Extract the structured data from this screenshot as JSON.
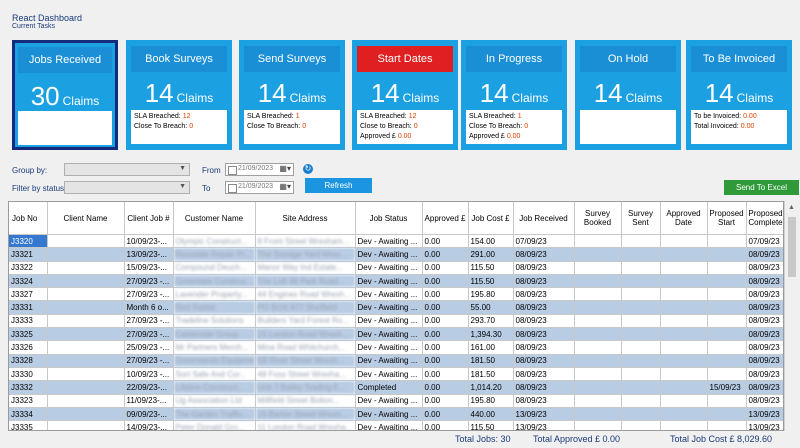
{
  "app": {
    "title": "React Dashboard",
    "subtitle": "Current Tasks"
  },
  "cards": [
    {
      "title": "Jobs Received",
      "count": "30",
      "unit": "Claims",
      "active": true,
      "lines": []
    },
    {
      "title": "Book Surveys",
      "count": "14",
      "unit": "Claims",
      "lines": [
        {
          "label": "SLA Breached:",
          "value": "12"
        },
        {
          "label": "Close To Breach:",
          "value": "0"
        }
      ]
    },
    {
      "title": "Send Surveys",
      "count": "14",
      "unit": "Claims",
      "lines": [
        {
          "label": "SLA Breached:",
          "value": "1"
        },
        {
          "label": "Close To Breach:",
          "value": "0"
        }
      ]
    },
    {
      "title": "Start Dates",
      "count": "14",
      "unit": "Claims",
      "red": true,
      "lines": [
        {
          "label": "SLA Breached:",
          "value": "12"
        },
        {
          "label": "Close to Breach:",
          "value": "0"
        },
        {
          "label": "Approved £",
          "value": "0.00"
        }
      ]
    },
    {
      "title": "In Progress",
      "count": "14",
      "unit": "Claims",
      "lines": [
        {
          "label": "SLA Breached:",
          "value": "1"
        },
        {
          "label": "Close To Breach:",
          "value": "0"
        },
        {
          "label": "Approved £",
          "value": "0.00"
        }
      ]
    },
    {
      "title": "On Hold",
      "count": "14",
      "unit": "Claims",
      "lines": []
    },
    {
      "title": "To Be Invoiced",
      "count": "14",
      "unit": "Claims",
      "lines": [
        {
          "label": "To be Invoiced:",
          "value": "0.00"
        },
        {
          "label": "Total Invoiced:",
          "value": "0.00"
        }
      ]
    }
  ],
  "filters": {
    "group_by_label": "Group by:",
    "filter_status_label": "Filter by status:",
    "from_label": "From",
    "to_label": "To",
    "from_date": "21/09/2023",
    "to_date": "21/09/2023",
    "refresh_label": "Refresh",
    "excel_label": "Send To Excel"
  },
  "table": {
    "columns": [
      "Job No",
      "Client Name",
      "Client Job #",
      "Customer Name",
      "Site Address",
      "Job Status",
      "Approved £",
      "Job Cost £",
      "Job Received",
      "Survey Booked",
      "Survey Sent",
      "Approved Date",
      "Proposed Start",
      "Proposed Complete"
    ],
    "rows": [
      [
        "J3320",
        "",
        "10/09/23-...",
        "Olympic Construct...",
        "8 Front Street Wrexham...",
        "Dev - Awaiting ...",
        "0.00",
        "154.00",
        "07/09/23",
        "",
        "",
        "",
        "",
        "07/09/23"
      ],
      [
        "J3321",
        "",
        "13/09/23-...",
        "Rossdale Repair Pr...",
        "The Storage Yard Wrex...",
        "Dev - Awaiting ...",
        "0.00",
        "291.00",
        "08/09/23",
        "",
        "",
        "",
        "",
        "08/09/23"
      ],
      [
        "J3322",
        "",
        "15/09/23-...",
        "Compound Deuch...",
        "Manor Way Ind Estate...",
        "Dev - Awaiting ...",
        "0.00",
        "115.50",
        "08/09/23",
        "",
        "",
        "",
        "",
        "08/09/23"
      ],
      [
        "J3324",
        "",
        "27/09/23 -...",
        "Greenlake Construc...",
        "The Loft 48 Park Road...",
        "Dev - Awaiting ...",
        "0.00",
        "115.50",
        "08/09/23",
        "",
        "",
        "",
        "",
        "08/09/23"
      ],
      [
        "J3327",
        "",
        "27/09/23 -...",
        "Lavender Property...",
        "44 Engines Road Wrexh...",
        "Dev - Awaiting ...",
        "0.00",
        "195.80",
        "08/09/23",
        "",
        "",
        "",
        "",
        "08/09/23"
      ],
      [
        "J3331",
        "",
        "Month 6 o...",
        "Red Rabbit",
        "PO BOX 877 Sheffield",
        "Dev - Awaiting ...",
        "0.00",
        "55.00",
        "08/09/23",
        "",
        "",
        "",
        "",
        "08/09/23"
      ],
      [
        "J3333",
        "",
        "27/09/23 -...",
        "Tradeline Solutions",
        "Builders Yard Forest Ro...",
        "Dev - Awaiting ...",
        "0.00",
        "293.70",
        "08/09/23",
        "",
        "",
        "",
        "",
        "08/09/23"
      ],
      [
        "J3325",
        "",
        "27/09/23 -...",
        "Calderside Group",
        "15 London Road Wrexh...",
        "Dev - Awaiting ...",
        "0.00",
        "1,394.30",
        "08/09/23",
        "",
        "",
        "",
        "",
        "08/09/23"
      ],
      [
        "J3326",
        "",
        "25/09/23 -...",
        "Mr Partners Merch...",
        "Mina Road Whitchurch...",
        "Dev - Awaiting ...",
        "0.00",
        "161.00",
        "08/09/23",
        "",
        "",
        "",
        "",
        "08/09/23"
      ],
      [
        "J3328",
        "",
        "27/09/23 -...",
        "Greensands Equipment...",
        "5B River Street Wrexh...",
        "Dev - Awaiting ...",
        "0.00",
        "181.50",
        "08/09/23",
        "",
        "",
        "",
        "",
        "08/09/23"
      ],
      [
        "J3330",
        "",
        "10/09/23 -...",
        "Sort Safe And Cor...",
        "48 Foss Street Wrexha...",
        "Dev - Awaiting ...",
        "0.00",
        "181.50",
        "08/09/23",
        "",
        "",
        "",
        "",
        "08/09/23"
      ],
      [
        "J3332",
        "",
        "22/09/23-...",
        "Lifeline Construct...",
        "Unit 7 Bailey Trading E...",
        "Completed",
        "0.00",
        "1,014.20",
        "08/09/23",
        "",
        "",
        "",
        "15/09/23",
        "08/09/23"
      ],
      [
        "J3323",
        "",
        "11/09/23-...",
        "Ug Association Ltd",
        "Millfield Street Bolton...",
        "Dev - Awaiting ...",
        "0.00",
        "195.80",
        "08/09/23",
        "",
        "",
        "",
        "",
        "08/09/23"
      ],
      [
        "J3334",
        "",
        "09/09/23-...",
        "The Garden Traffic...",
        "16 Barton Street Wrexh...",
        "Dev - Awaiting ...",
        "0.00",
        "440.00",
        "13/09/23",
        "",
        "",
        "",
        "",
        "13/09/23"
      ],
      [
        "J3335",
        "",
        "14/09/23-...",
        "Peter Donald Gro...",
        "11 London Road Wrexha...",
        "Dev - Awaiting ...",
        "0.00",
        "115.50",
        "13/09/23",
        "",
        "",
        "",
        "",
        "13/09/23"
      ],
      [
        "J3336",
        "",
        "14/09/23-...",
        "Attractive North Ws...",
        "71-73 Church Street Wr...",
        "Completed",
        "0.00",
        "165.00",
        "13/09/23",
        "",
        "",
        "",
        "14/09/23",
        "13/09/23"
      ]
    ]
  },
  "totals": {
    "jobs": "Total Jobs: 30",
    "approved": "Total Approved £ 0.00",
    "cost": "Total Job Cost £  8,029.60"
  }
}
